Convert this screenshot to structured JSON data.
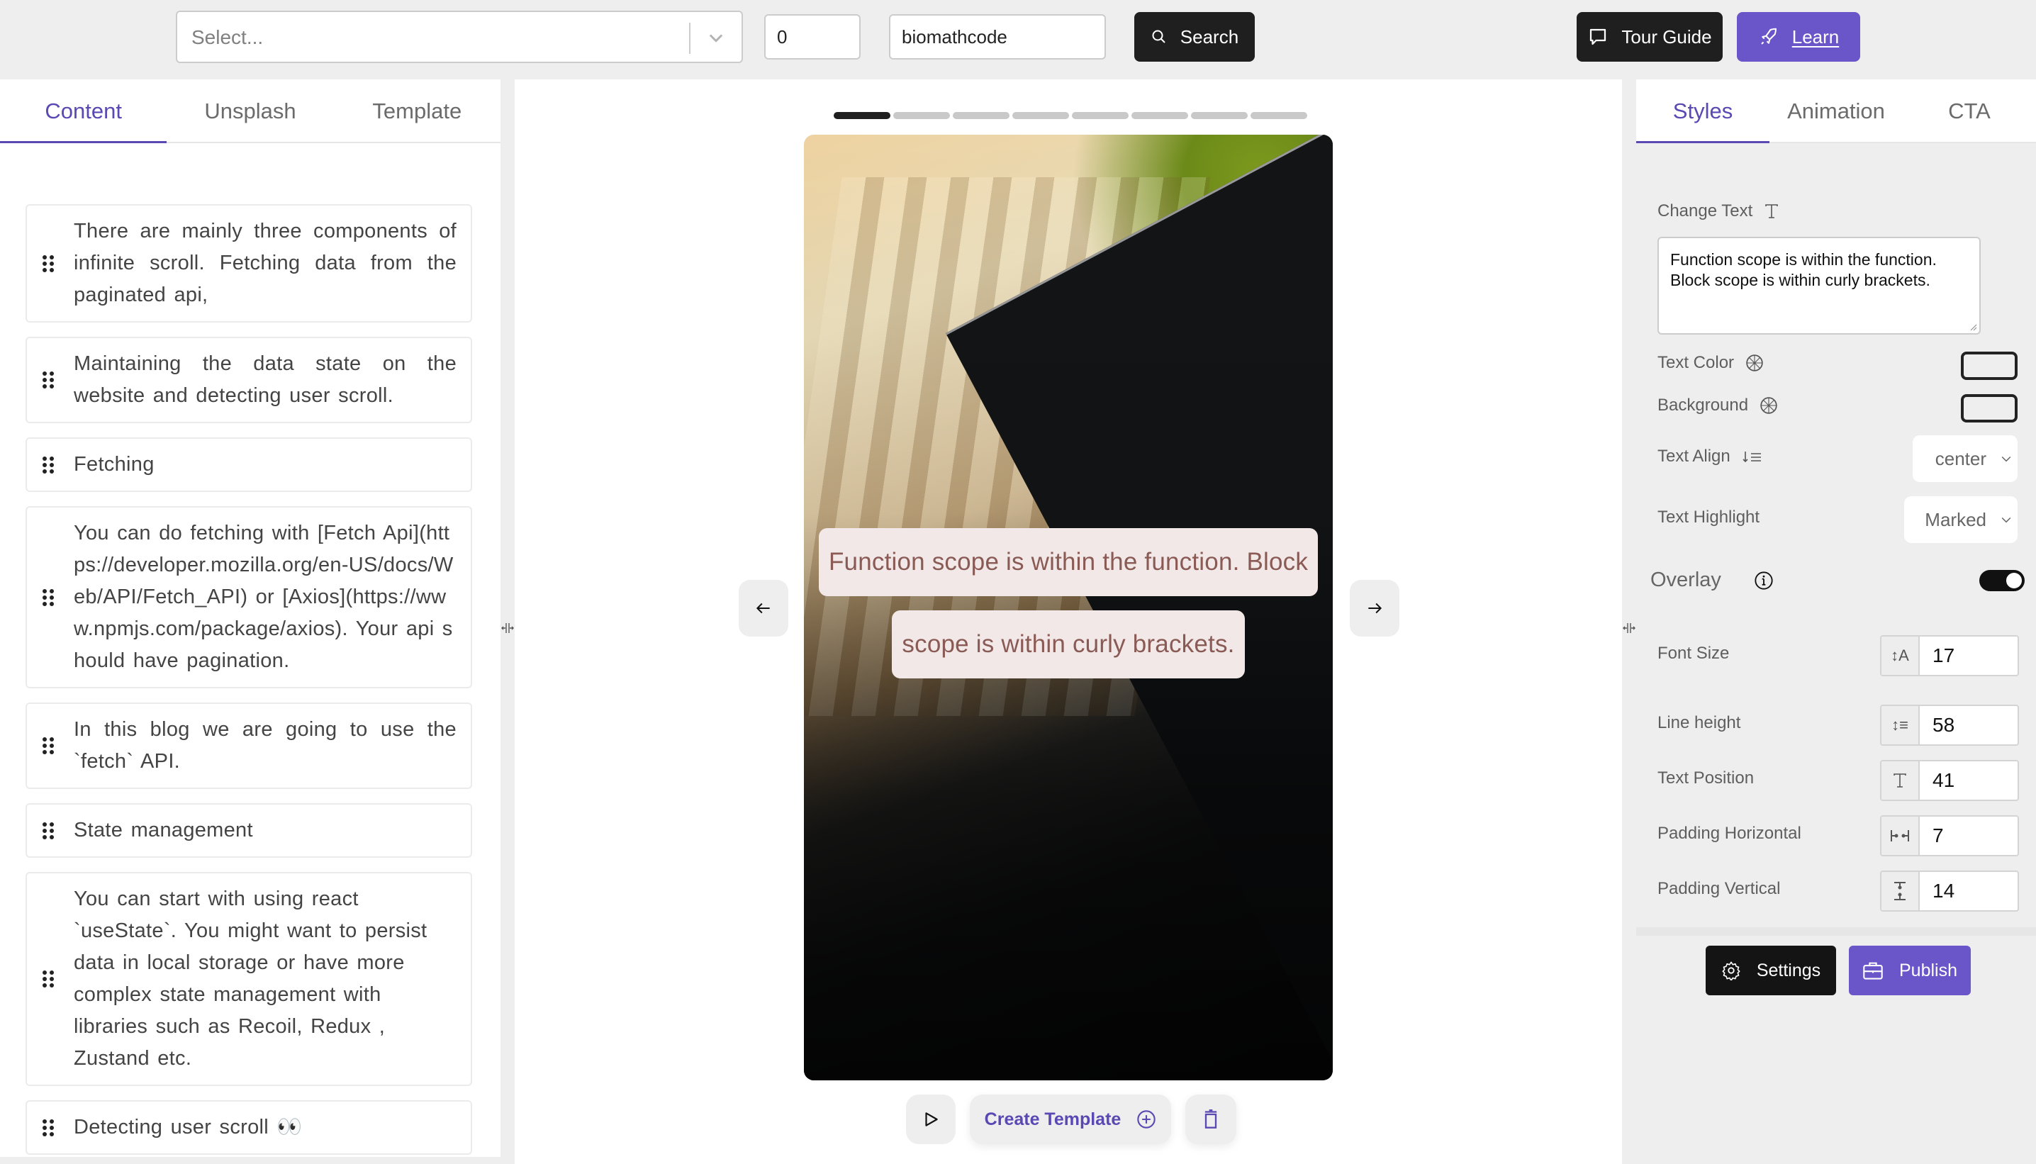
{
  "topbar": {
    "select_placeholder": "Select...",
    "number_value": "0",
    "text_value": "biomathcode",
    "search_label": "Search",
    "tour_label": "Tour Guide",
    "learn_label": "Learn"
  },
  "left_panel": {
    "tabs": [
      {
        "label": "Content",
        "active": true
      },
      {
        "label": "Unsplash",
        "active": false
      },
      {
        "label": "Template",
        "active": false
      }
    ],
    "items": [
      "There are mainly three components of infinite scroll. Fetching data from the paginated api,",
      "Maintaining the data state on the website and detecting user scroll.",
      "Fetching",
      "You can do fetching with [Fetch Api](https://developer.mozilla.org/en-US/docs/Web/API/Fetch_API) or [Axios](https://www.npmjs.com/package/axios). Your api should have pagination.",
      "In this blog we are going to use the `fetch` API.",
      "State management",
      "You can start with using react `useState`. You might want to persist data in local storage or have more complex state management with libraries such as Recoil, Redux , Zustand etc.",
      "Detecting user scroll 👀"
    ]
  },
  "center": {
    "slides_total": 8,
    "slide_current": 1,
    "caption_lines": [
      "Function scope is within the function. Block",
      "scope is within curly brackets."
    ],
    "create_template_label": "Create Template"
  },
  "right_panel": {
    "tabs": [
      {
        "label": "Styles",
        "active": true
      },
      {
        "label": "Animation",
        "active": false
      },
      {
        "label": "CTA",
        "active": false
      }
    ],
    "change_text_label": "Change Text",
    "change_text_value": "Function scope is within the function.\nBlock scope is within curly brackets.",
    "text_color_label": "Text Color",
    "background_label": "Background",
    "text_align_label": "Text Align",
    "text_align_value": "center",
    "text_highlight_label": "Text Highlight",
    "text_highlight_value": "Marked",
    "overlay_label": "Overlay",
    "overlay_on": true,
    "font_size_label": "Font Size",
    "font_size_value": "17",
    "line_height_label": "Line height",
    "line_height_value": "58",
    "text_position_label": "Text Position",
    "text_position_value": "41",
    "padding_h_label": "Padding Horizontal",
    "padding_h_value": "7",
    "padding_v_label": "Padding Vertical",
    "padding_v_value": "14",
    "settings_label": "Settings",
    "publish_label": "Publish"
  },
  "colors": {
    "accent": "#5a48b3",
    "button_purple": "#6a55c9",
    "button_dark": "#1f1f1f",
    "caption_bg": "#f1e8e7",
    "caption_text": "#8a5a55"
  }
}
